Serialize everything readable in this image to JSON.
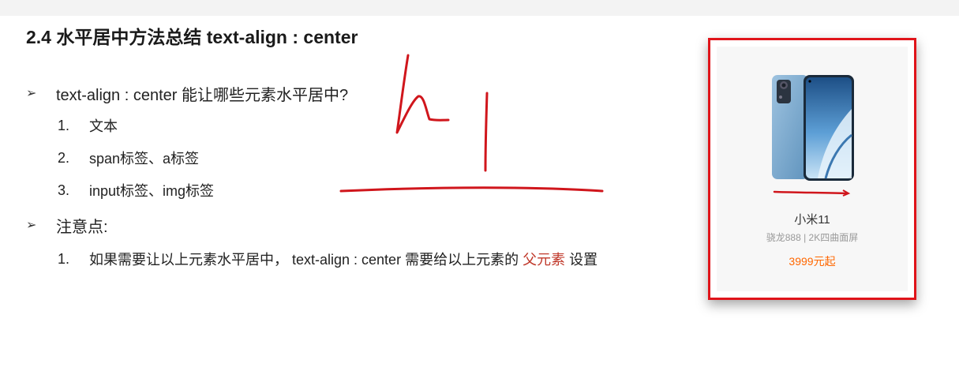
{
  "slide": {
    "title": "2.4 水平居中方法总结 text-align : center",
    "bullets": [
      {
        "arrow": "➢",
        "text": "text-align : center 能让哪些元素水平居中?",
        "items": [
          {
            "num": "1.",
            "text": "文本"
          },
          {
            "num": "2.",
            "text": "span标签、a标签"
          },
          {
            "num": "3.",
            "text": "input标签、img标签"
          }
        ]
      },
      {
        "arrow": "➢",
        "text": "注意点:",
        "items": [
          {
            "num": "1.",
            "text_before": "如果需要让以上元素水平居中， text-align : center 需要给以上元素的 ",
            "highlight": "父元素",
            "text_after": " 设置"
          }
        ]
      }
    ]
  },
  "product_card": {
    "image": "phone-icon",
    "name": "小米11",
    "desc": "骁龙888 | 2K四曲面屏",
    "price": "3999元起",
    "colors": {
      "border": "#e0141a",
      "price": "#ff6700"
    }
  },
  "annotations": {
    "ink_color": "#d0161c"
  }
}
